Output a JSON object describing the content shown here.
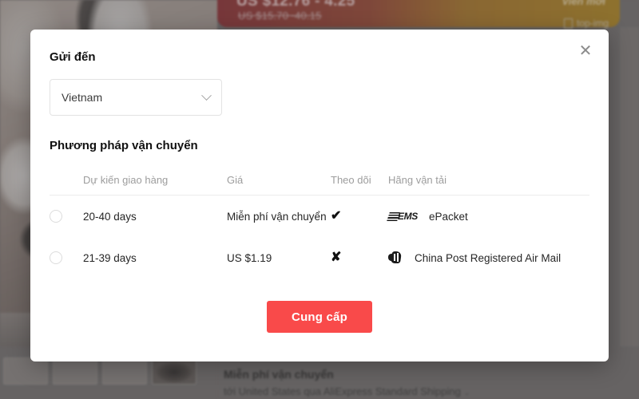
{
  "background": {
    "banner": {
      "price_new": "US $12.76 - 4.25",
      "price_old": "US $15.70~40.15",
      "link_label": "Viền mới",
      "top_img_label": "top-img"
    },
    "detail": {
      "title": "Miễn phí vận chuyển",
      "subtitle": "tới United States qua AliExpress Standard Shipping",
      "caret": "⌄"
    },
    "thumbnails": [
      "",
      "",
      "",
      ""
    ]
  },
  "modal": {
    "close_label": "✕",
    "ship_to_label": "Gửi đến",
    "country": {
      "selected": "Vietnam",
      "chevron": "chevron-down-icon"
    },
    "method_label": "Phương pháp vận chuyển",
    "table": {
      "headers": {
        "eta": "Dự kiến giao hàng",
        "price": "Giá",
        "tracking": "Theo dõi",
        "carrier": "Hãng vận tải"
      },
      "rows": [
        {
          "selected": false,
          "eta": "20-40 days",
          "price": "Miễn phí vận chuyển",
          "tracking": "✔",
          "tracking_available": true,
          "carrier_logo": "ems-logo",
          "carrier": "ePacket"
        },
        {
          "selected": false,
          "eta": "21-39 days",
          "price": "US $1.19",
          "tracking": "✘",
          "tracking_available": false,
          "carrier_logo": "china-post-logo",
          "carrier": "China Post Registered Air Mail"
        }
      ]
    },
    "submit_label": "Cung cấp"
  },
  "colors": {
    "accent": "#f94a4a",
    "text": "#262626",
    "muted": "#9d9d9d",
    "border": "#ececec"
  }
}
